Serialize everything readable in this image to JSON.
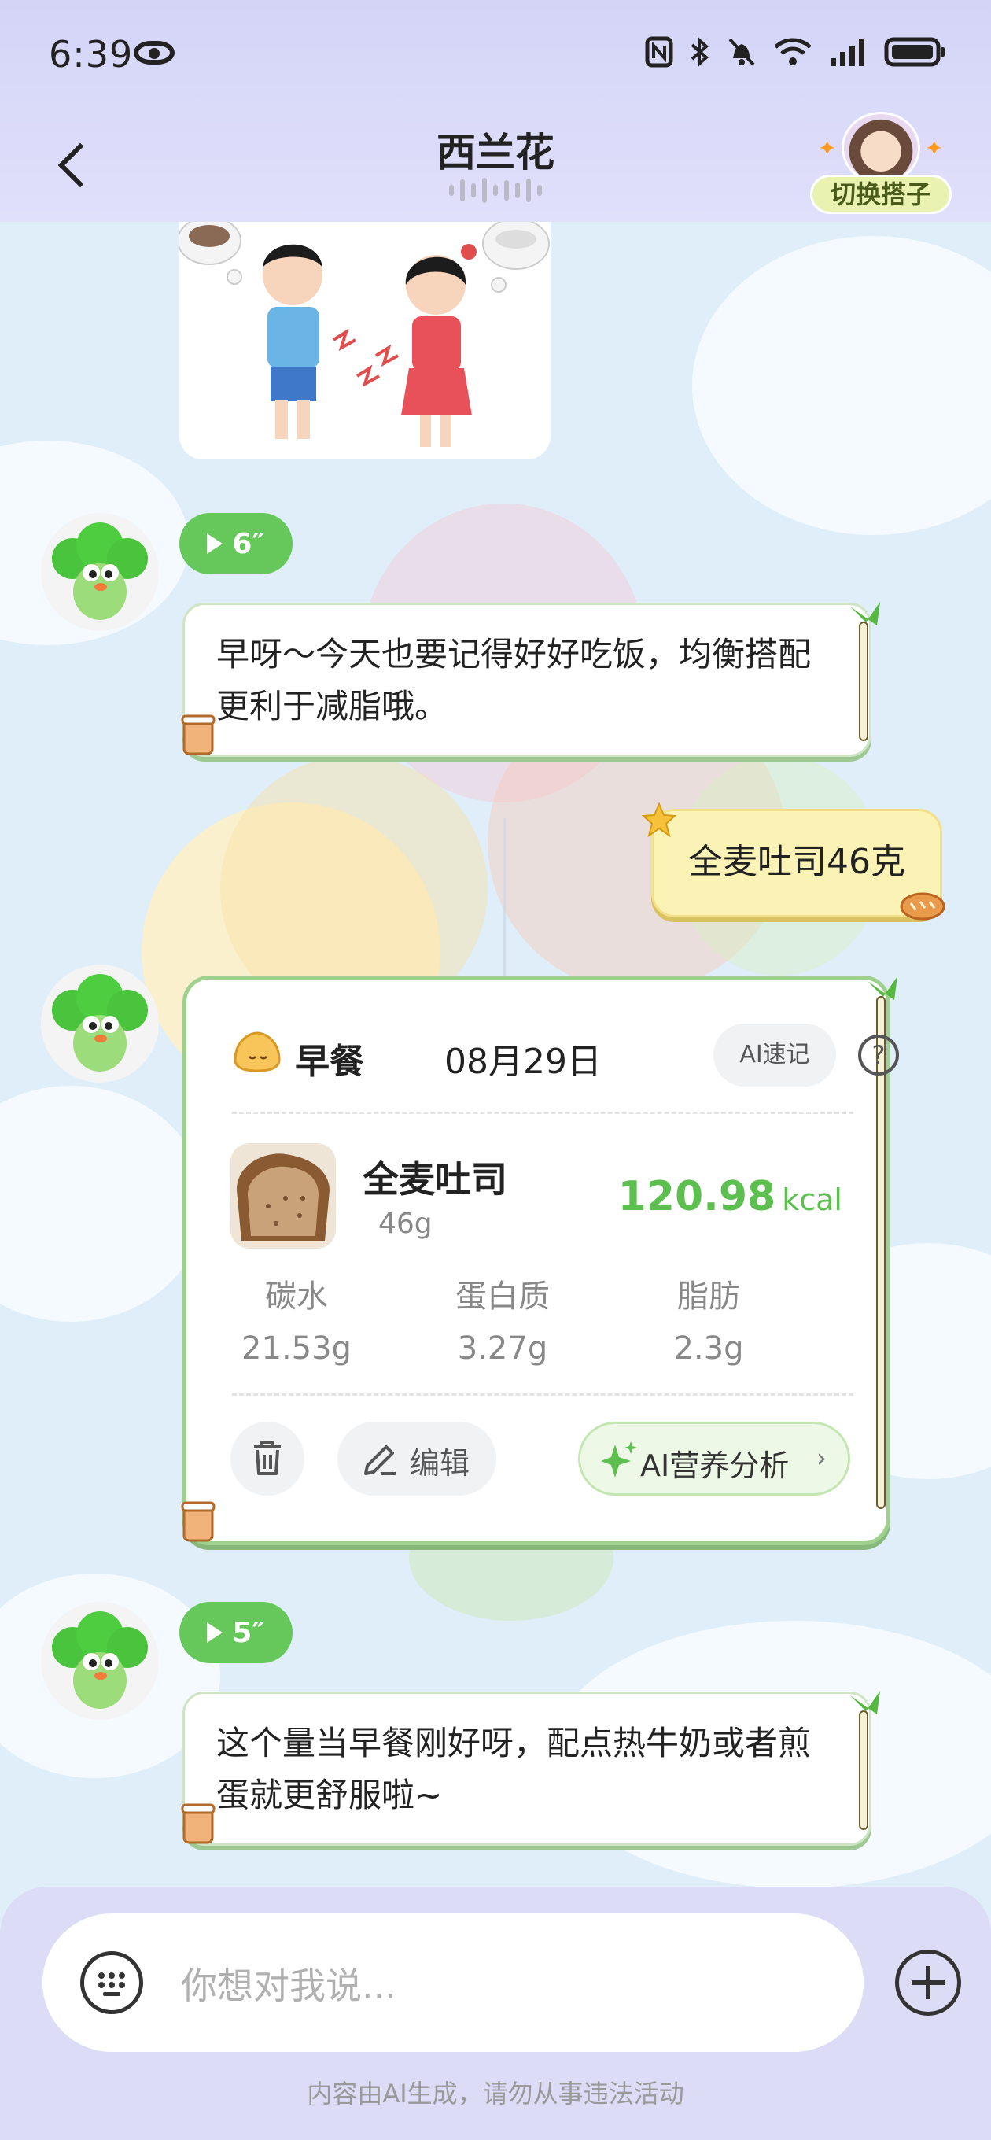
{
  "status_bar": {
    "time": "6:39",
    "icons": [
      "eye-icon",
      "nfc-icon",
      "bluetooth-icon",
      "mute-icon",
      "wifi-icon",
      "signal-icon",
      "battery-icon"
    ]
  },
  "header": {
    "title": "西兰花",
    "switch_partner_label": "切换搭子"
  },
  "messages": [
    {
      "type": "image",
      "sender": "ai",
      "icon": "stomach-ache-illustration"
    },
    {
      "type": "ai_voice",
      "duration": "6″",
      "text": "早呀～今天也要记得好好吃饭，均衡搭配更利于减脂哦。"
    },
    {
      "type": "user",
      "text": "全麦吐司46克"
    },
    {
      "type": "ai_voice",
      "duration": "5″",
      "text": "这个量当早餐刚好呀，配点热牛奶或者煎蛋就更舒服啦~"
    }
  ],
  "food_card": {
    "meal": "早餐",
    "date": "08月29日",
    "ai_quick_label": "AI速记",
    "help_label": "?",
    "food": {
      "name": "全麦吐司",
      "weight": "46g",
      "kcal": "120.98",
      "kcal_unit": "kcal"
    },
    "nutrients": [
      {
        "label": "碳水",
        "value": "21.53g"
      },
      {
        "label": "蛋白质",
        "value": "3.27g"
      },
      {
        "label": "脂肪",
        "value": "2.3g"
      }
    ],
    "edit_label": "编辑",
    "ai_analysis_label": "AI营养分析",
    "chevron": "›"
  },
  "input": {
    "placeholder": "你想对我说..."
  },
  "disclaimer": "内容由AI生成，请勿从事违法活动",
  "colors": {
    "header_bg": "#d4d4f7",
    "accent_green": "#5cbf4f",
    "voice_pill": "#66c75a",
    "user_bubble": "#fbf2b6",
    "chat_bg": "#dfeef8"
  }
}
